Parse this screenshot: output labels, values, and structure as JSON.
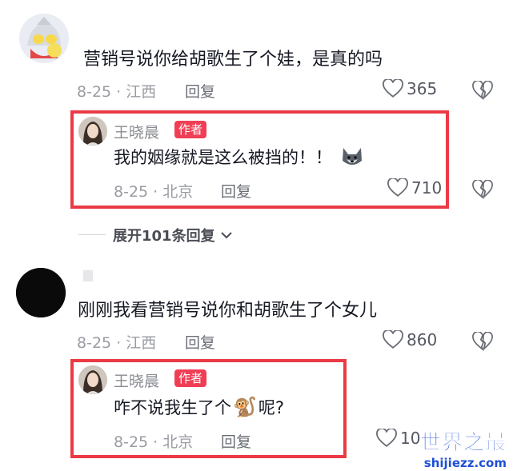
{
  "comments": [
    {
      "text": "营销号说你给胡歌生了个娃，是真的吗",
      "meta": "8-25 · 江西",
      "reply_label": "回复",
      "likes": "365",
      "avatar_icon": "ultraman-avatar",
      "reply": {
        "username": "王晓晨",
        "badge": "作者",
        "text": "我的姻缘就是这么被挡的！！",
        "emoji_icon": "husky-dog-emoji",
        "meta": "8-25 · 北京",
        "reply_label": "回复",
        "likes": "710"
      },
      "expand_label": "展开101条回复"
    },
    {
      "text": "刚刚我看营销号说你和胡歌生了个女儿",
      "meta": "8-25 · 江西",
      "reply_label": "回复",
      "likes": "860",
      "avatar_icon": "black-avatar",
      "reply": {
        "username": "王晓晨",
        "badge": "作者",
        "text_before": "咋不说我生了个",
        "emoji": "🐒",
        "text_after": "呢?",
        "meta": "8-25 · 北京",
        "reply_label": "回复",
        "likes": "10"
      }
    }
  ],
  "watermark": {
    "title": "世界之最",
    "url": "shijiezz.com"
  },
  "colors": {
    "highlight_border": "#ea3b45",
    "author_badge": "#f03e55",
    "watermark": "#1f4fd6"
  }
}
